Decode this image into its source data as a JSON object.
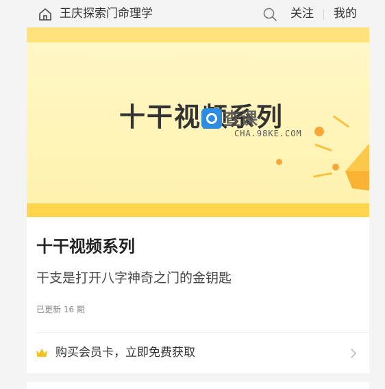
{
  "header": {
    "shop_title": "王庆探索门命理学",
    "follow_label": "关注",
    "mine_label": "我的",
    "home_icon": "home-icon",
    "search_icon": "search-icon"
  },
  "banner": {
    "title": "十干视频系列",
    "watermark_text": "查课",
    "watermark_url": "CHA.98KE.COM",
    "colors": {
      "background": "#fff3b8",
      "stripe": "#ffd54d",
      "accent": "#f7a63a"
    }
  },
  "course": {
    "title": "十干视频系列",
    "subtitle": "干支是打开八字神奇之门的金钥匙",
    "update_info": "已更新 16 期"
  },
  "member": {
    "label": "购买会员卡，立即免费获取",
    "crown_icon": "crown-icon",
    "chevron_icon": "chevron-right-icon",
    "crown_color": "#f5c21b"
  }
}
